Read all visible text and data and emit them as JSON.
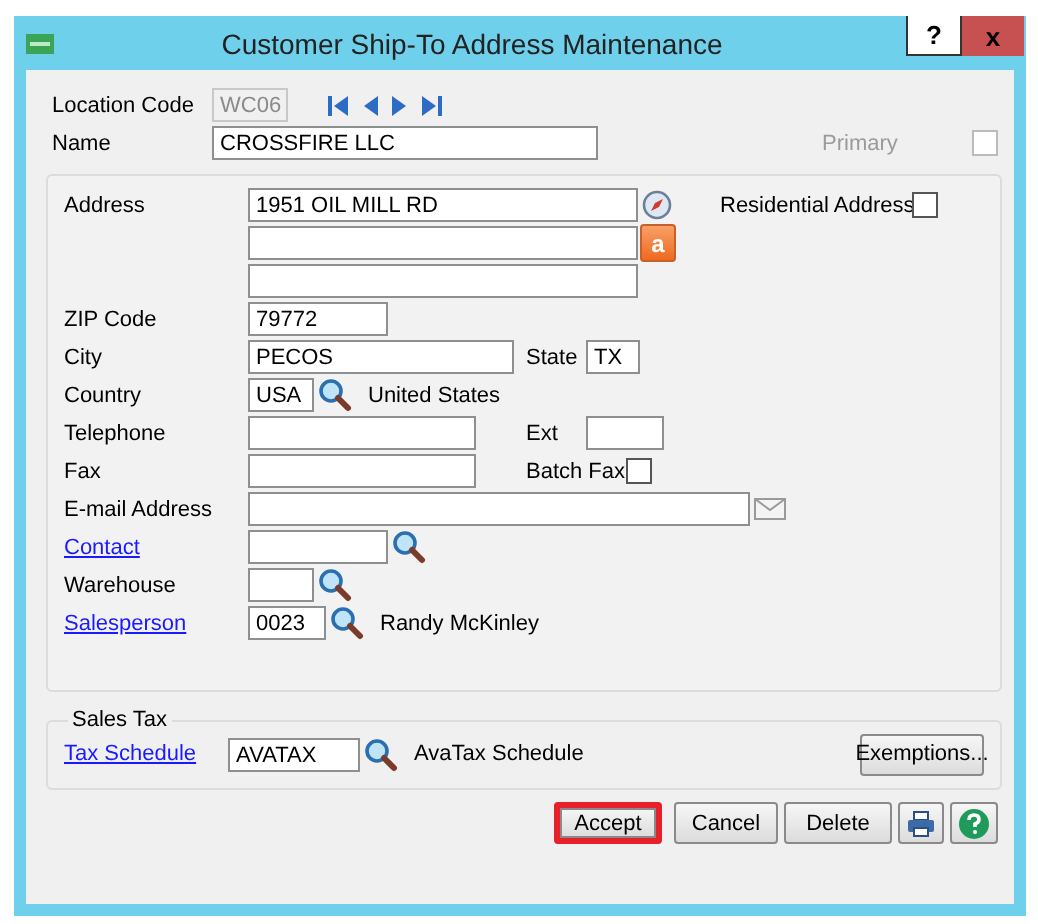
{
  "window": {
    "title": "Customer Ship-To Address Maintenance",
    "help": "?",
    "close": "x"
  },
  "header": {
    "location_code": {
      "label": "Location Code",
      "value": "WC06",
      "disabled": true
    },
    "name": {
      "label": "Name",
      "value": "CROSSFIRE LLC"
    },
    "primary": {
      "label": "Primary",
      "checked": false,
      "disabled": true
    }
  },
  "address_section": {
    "address": {
      "label": "Address",
      "line_1": "1951 OIL MILL RD"
    },
    "avatax_button": {
      "glyph": "a"
    },
    "residential": {
      "label": "Residential Address",
      "checked": false
    },
    "zip": {
      "label": "ZIP Code",
      "value": "79772"
    },
    "city": {
      "label": "City",
      "value": "PECOS"
    },
    "state": {
      "label": "State",
      "value": "TX"
    },
    "country": {
      "label": "Country",
      "value": "USA",
      "description": "United States"
    },
    "telephone": {
      "label": "Telephone"
    },
    "ext": {
      "label": "Ext"
    },
    "fax": {
      "label": "Fax"
    },
    "batch_fax": {
      "label": "Batch Fax",
      "checked": false
    },
    "email": {
      "label": "E-mail Address"
    },
    "contact": {
      "label": "Contact",
      "link": true
    },
    "warehouse": {
      "label": "Warehouse",
      "link": false
    },
    "salesperson": {
      "label": "Salesperson",
      "link": true,
      "value": "0023",
      "description": "Randy McKinley"
    }
  },
  "sales_tax": {
    "title": "Sales Tax",
    "schedule": {
      "label": "Tax Schedule",
      "link": true,
      "value": "AVATAX",
      "description": "AvaTax Schedule"
    },
    "exemptions_button": "Exemptions..."
  },
  "buttons": [
    {
      "label": "Accept",
      "highlighted": true
    },
    {
      "label": "Cancel",
      "highlighted": false
    },
    {
      "label": "Delete",
      "highlighted": false
    }
  ]
}
